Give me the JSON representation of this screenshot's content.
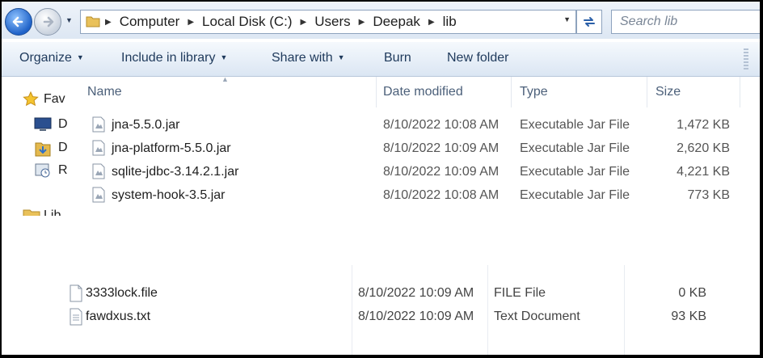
{
  "address": {
    "crumbs": [
      "Computer",
      "Local Disk (C:)",
      "Users",
      "Deepak",
      "lib"
    ]
  },
  "search": {
    "placeholder": "Search lib"
  },
  "toolbar": {
    "organize": "Organize",
    "include": "Include in library",
    "share": "Share with",
    "burn": "Burn",
    "new_folder": "New folder"
  },
  "nav": {
    "items": [
      {
        "label": "Fav",
        "icon": "star-icon"
      },
      {
        "label": "D",
        "icon": "desktop-icon"
      },
      {
        "label": "D",
        "icon": "downloads-icon"
      },
      {
        "label": "R",
        "icon": "recent-places-icon"
      },
      {
        "label": "Lib",
        "icon": "libraries-icon"
      }
    ]
  },
  "columns": {
    "name": "Name",
    "date": "Date modified",
    "type": "Type",
    "size": "Size"
  },
  "files": [
    {
      "name": "jna-5.5.0.jar",
      "date": "8/10/2022 10:08 AM",
      "type": "Executable Jar File",
      "size": "1,472 KB",
      "icon": "jar-file-icon"
    },
    {
      "name": "jna-platform-5.5.0.jar",
      "date": "8/10/2022 10:09 AM",
      "type": "Executable Jar File",
      "size": "2,620 KB",
      "icon": "jar-file-icon"
    },
    {
      "name": "sqlite-jdbc-3.14.2.1.jar",
      "date": "8/10/2022 10:09 AM",
      "type": "Executable Jar File",
      "size": "4,221 KB",
      "icon": "jar-file-icon"
    },
    {
      "name": "system-hook-3.5.jar",
      "date": "8/10/2022 10:08 AM",
      "type": "Executable Jar File",
      "size": "773 KB",
      "icon": "jar-file-icon"
    }
  ],
  "lower_files": [
    {
      "name": "3333lock.file",
      "date": "8/10/2022 10:09 AM",
      "type": "FILE File",
      "size": "0 KB",
      "icon": "generic-file-icon"
    },
    {
      "name": "fawdxus.txt",
      "date": "8/10/2022 10:09 AM",
      "type": "Text Document",
      "size": "93 KB",
      "icon": "text-file-icon"
    }
  ]
}
